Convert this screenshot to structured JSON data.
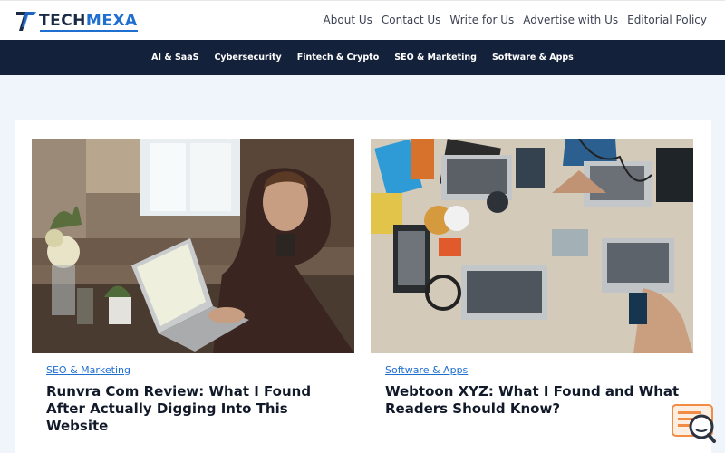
{
  "header": {
    "logo_text_1": "TECH",
    "logo_text_2": "MEXA",
    "nav": [
      "About Us",
      "Contact Us",
      "Write for Us",
      "Advertise with Us",
      "Editorial Policy"
    ]
  },
  "categories": [
    "AI & SaaS",
    "Cybersecurity",
    "Fintech & Crypto",
    "SEO & Marketing",
    "Software & Apps"
  ],
  "posts": [
    {
      "category": "SEO & Marketing",
      "title": "Runvra Com Review: What I Found After Actually Digging Into This Website",
      "image": "man-at-laptop-photo"
    },
    {
      "category": "Software & Apps",
      "title": "Webtoon XYZ: What I Found and What Readers Should Know?",
      "image": "desk-with-laptops-photo"
    }
  ],
  "colors": {
    "navy": "#14213a",
    "accent": "#1f6fd1",
    "widget": "#f28b44"
  },
  "icons": {
    "logo": "techmexa-logo-icon",
    "widget": "search-chat-widget-icon"
  }
}
